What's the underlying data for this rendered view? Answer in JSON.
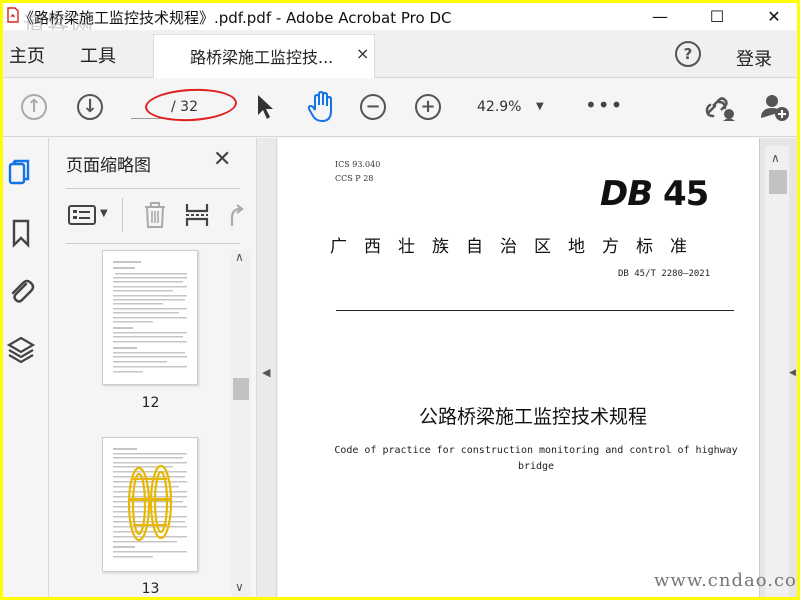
{
  "window": {
    "title": "《路桥梁施工监控技术规程》.pdf.pdf - Adobe Acrobat Pro DC",
    "app_icon": "acrobat-icon",
    "watermark": "道客网",
    "buttons": {
      "minimize": "—",
      "maximize": "☐",
      "close": "✕"
    }
  },
  "nav": {
    "home": "主页",
    "tools": "工具",
    "doc_tab": "路桥梁施工监控技...",
    "doc_tab_close": "×",
    "help": "?",
    "login": "登录"
  },
  "toolbar": {
    "prev_page_icon": "arrow-up-circle-icon",
    "next_page_icon": "arrow-down-circle-icon",
    "page_value": "",
    "page_total": "/ 32",
    "zoom_out": "−",
    "zoom_in": "+",
    "zoom": "42.9%",
    "more": "•••"
  },
  "sidebar": {
    "items": [
      "pages-icon",
      "bookmark-icon",
      "attachment-icon",
      "layers-icon"
    ]
  },
  "thumbnails_panel": {
    "title": "页面缩略图",
    "close": "✕",
    "pages": [
      {
        "number": "12"
      },
      {
        "number": "13"
      }
    ]
  },
  "document": {
    "ics": "ICS  93.040",
    "ccs": "CCS  P  28",
    "logo_prefix": "DB",
    "logo_number": "45",
    "province": "广西壮族自治区地方标准",
    "standard_number": "DB 45/T 2280—2021",
    "title_cn": "公路桥梁施工监控技术规程",
    "title_en": "Code of practice for construction monitoring and control of highway bridge"
  },
  "footer_watermark": "www.cndao.com",
  "colors": {
    "frame_border": "#ffff00",
    "annotation_oval": "#e02020",
    "hand_tool_active": "#1473e6",
    "acrobat_red": "#d9251b"
  }
}
